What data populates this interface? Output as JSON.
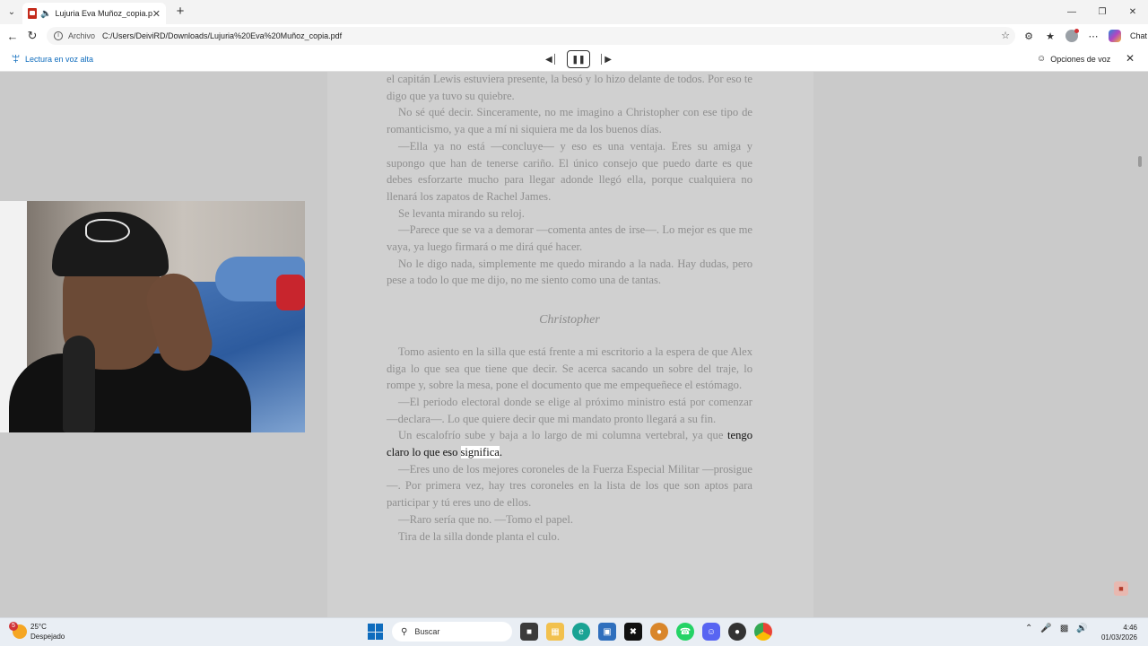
{
  "browser": {
    "tab": {
      "title": "Lujuria Eva Muñoz_copia.pdf"
    },
    "address": {
      "scheme": "Archivo",
      "url": "C:/Users/DeiviRD/Downloads/Lujuria%20Eva%20Muñoz_copia.pdf"
    },
    "chat_label": "Chat"
  },
  "read_aloud": {
    "label": "Lectura en voz alta",
    "voice_options": "Opciones de voz"
  },
  "document": {
    "paragraphs_top": [
      "el capitán Lewis estuviera presente, la besó y lo hizo delante de todos. Por eso te digo que ya tuvo su quiebre.",
      "No sé qué decir. Sinceramente, no me imagino a Christopher con ese tipo de romanticismo, ya que a mí ni siquiera me da los buenos días.",
      "—Ella ya no está —concluye— y eso es una ventaja. Eres su amiga y supongo que han de tenerse cariño. El único consejo que puedo darte es que debes esforzarte mucho para llegar adonde llegó ella, porque cualquiera no llenará los zapatos de Rachel James.",
      "Se levanta mirando su reloj.",
      "—Parece que se va a demorar —comenta antes de irse—. Lo mejor es que me vaya, ya luego firmará o me dirá qué hacer.",
      "No le digo nada, simplemente me quedo mirando a la nada. Hay dudas, pero pese a todo lo que me dijo, no me siento como una de tantas."
    ],
    "heading": "Christopher",
    "paragraphs_bottom": [
      "Tomo asiento en la silla que está frente a mi escritorio a la espera de que Alex diga lo que sea que tiene que decir. Se acerca sacando un sobre del traje, lo rompe y, sobre la mesa, pone el documento que me empequeñece el estómago.",
      "—El periodo electoral donde se elige al próximo ministro está por comenzar —declara—. Lo que quiere decir que mi mandato pronto llegará a su fin."
    ],
    "reading_para": {
      "before": "Un escalofrío sube y baja a lo largo de mi columna vertebral, ya que",
      "spoken": "tengo claro lo que eso ",
      "current_word": "significa",
      "after": "."
    },
    "paragraphs_end": [
      "—Eres uno de los mejores coroneles de la Fuerza Especial Militar —prosigue—. Por primera vez, hay tres coroneles en la lista de los que son aptos para participar y tú eres uno de ellos.",
      "—Raro sería que no. —Tomo el papel.",
      "Tira de la silla donde planta el culo."
    ]
  },
  "taskbar": {
    "weather": {
      "badge": "5",
      "temp": "25°C",
      "condition": "Despejado"
    },
    "search_placeholder": "Buscar",
    "time": "4:46",
    "date": "01/03/2026"
  }
}
